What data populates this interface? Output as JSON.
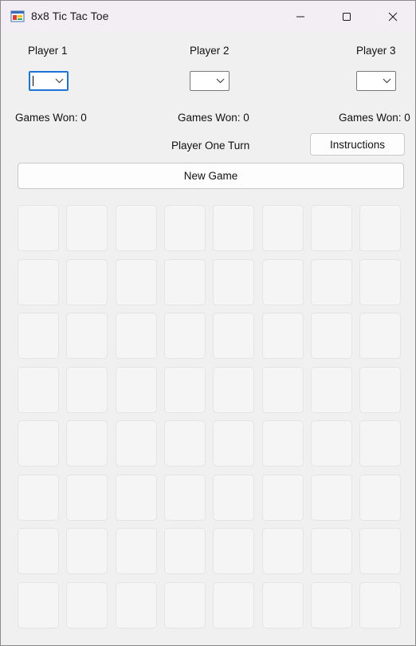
{
  "window": {
    "title": "8x8 Tic Tac Toe"
  },
  "players": [
    {
      "label": "Player 1",
      "selected": "",
      "games_won": "Games Won: 0"
    },
    {
      "label": "Player 2",
      "selected": "",
      "games_won": "Games Won: 0"
    },
    {
      "label": "Player 3",
      "selected": "",
      "games_won": "Games Won: 0"
    }
  ],
  "status": {
    "turn": "Player One Turn"
  },
  "buttons": {
    "instructions": "Instructions",
    "new_game": "New Game"
  },
  "board": {
    "rows": 8,
    "cols": 8,
    "cells": [
      [
        "",
        "",
        "",
        "",
        "",
        "",
        "",
        ""
      ],
      [
        "",
        "",
        "",
        "",
        "",
        "",
        "",
        ""
      ],
      [
        "",
        "",
        "",
        "",
        "",
        "",
        "",
        ""
      ],
      [
        "",
        "",
        "",
        "",
        "",
        "",
        "",
        ""
      ],
      [
        "",
        "",
        "",
        "",
        "",
        "",
        "",
        ""
      ],
      [
        "",
        "",
        "",
        "",
        "",
        "",
        "",
        ""
      ],
      [
        "",
        "",
        "",
        "",
        "",
        "",
        "",
        ""
      ],
      [
        "",
        "",
        "",
        "",
        "",
        "",
        "",
        ""
      ]
    ]
  },
  "icons": {
    "app": "app-icon",
    "minimize": "minimize-icon",
    "maximize": "maximize-icon",
    "close": "close-icon",
    "dropdown": "chevron-down-icon"
  }
}
